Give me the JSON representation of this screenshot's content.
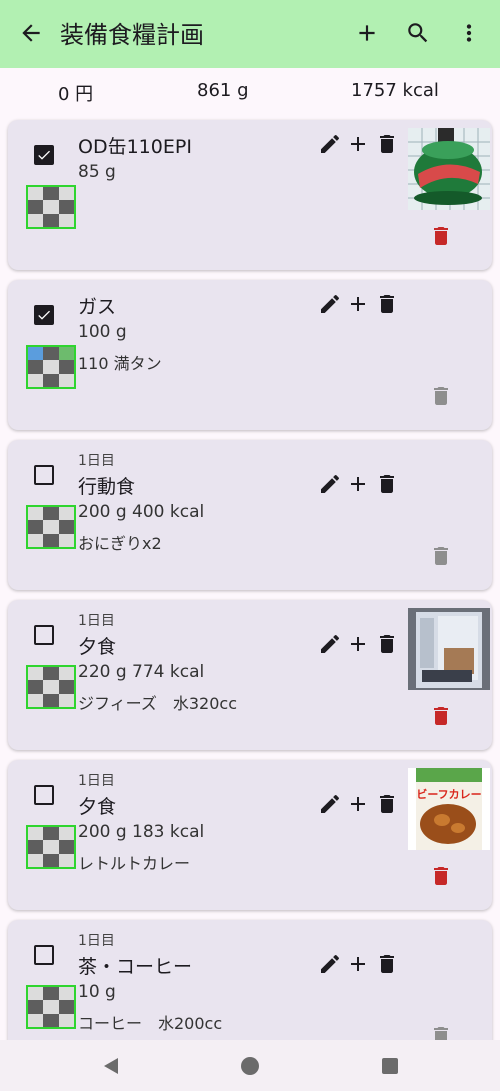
{
  "app": {
    "title": "装備食糧計画"
  },
  "summary": {
    "price": "0 円",
    "weight": "861 g",
    "calories": "1757 kcal"
  },
  "items": [
    {
      "checked": true,
      "day": "",
      "name": "OD缶110EPI",
      "info": "85 g",
      "note": ""
    },
    {
      "checked": true,
      "day": "",
      "name": "ガス",
      "info": "100 g",
      "note": "110 満タン"
    },
    {
      "checked": false,
      "day": "1日目",
      "name": "行動食",
      "info": "200 g  400 kcal",
      "note": "おにぎりx2"
    },
    {
      "checked": false,
      "day": "1日目",
      "name": "夕食",
      "info": "220 g  774 kcal",
      "note": "ジフィーズ　水320cc"
    },
    {
      "checked": false,
      "day": "1日目",
      "name": "夕食",
      "info": "200 g  183 kcal",
      "note": "レトルトカレー"
    },
    {
      "checked": false,
      "day": "1日目",
      "name": "茶・コーヒー",
      "info": "10 g",
      "note": "コーヒー　水200cc"
    }
  ],
  "photo_text": {
    "item4": "ビーフカレー"
  },
  "icons": {
    "back": "arrow-back-icon",
    "add": "plus-icon",
    "search": "search-icon",
    "menu": "more-vert-icon",
    "edit": "pencil-icon",
    "delete": "trash-icon"
  },
  "colors": {
    "appbar": "#b2f0b2",
    "background": "#fdf7fc",
    "card": "#e9e4ef",
    "delete_active": "#c62828",
    "delete_disabled": "#8e8e8e",
    "thumb_border": "#2fd52f"
  }
}
